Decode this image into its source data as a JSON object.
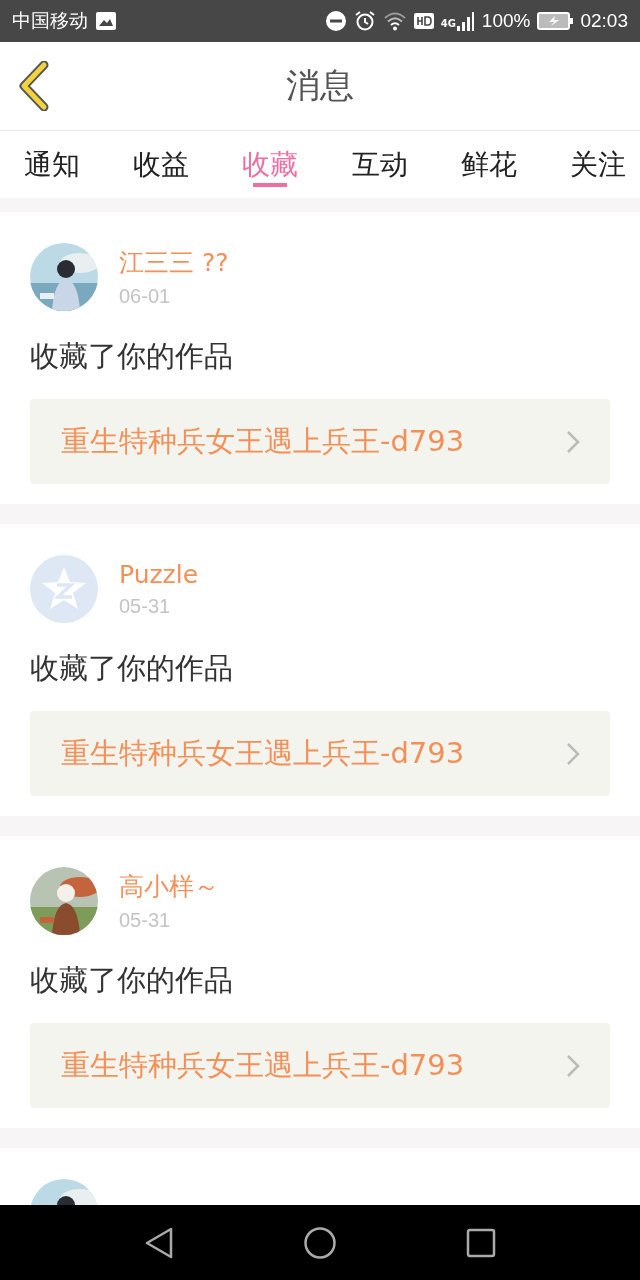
{
  "status_bar": {
    "carrier": "中国移动",
    "network": "4G",
    "battery": "100%",
    "time": "02:03"
  },
  "header": {
    "title": "消息"
  },
  "tabs": [
    {
      "label": "通知",
      "selected": false
    },
    {
      "label": "收益",
      "selected": false
    },
    {
      "label": "收藏",
      "selected": true
    },
    {
      "label": "互动",
      "selected": false
    },
    {
      "label": "鲜花",
      "selected": false
    },
    {
      "label": "关注",
      "selected": false
    }
  ],
  "messages": [
    {
      "avatar": {
        "kind": "picture"
      },
      "name": "江三三 ??",
      "date": "06-01",
      "action": "收藏了你的作品",
      "work": "重生特种兵女王遇上兵王-d793"
    },
    {
      "avatar": {
        "kind": "default"
      },
      "name": "Puzzle",
      "date": "05-31",
      "action": "收藏了你的作品",
      "work": "重生特种兵女王遇上兵王-d793"
    },
    {
      "avatar": {
        "kind": "picture"
      },
      "name": "高小样～",
      "date": "05-31",
      "action": "收藏了你的作品",
      "work": "重生特种兵女王遇上兵王-d793"
    },
    {
      "avatar": {
        "kind": "picture"
      }
    }
  ]
}
